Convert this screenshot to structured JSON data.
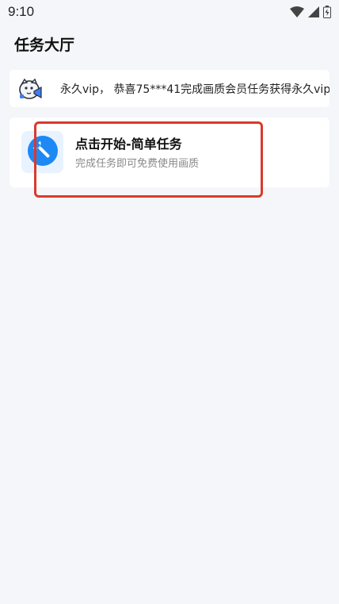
{
  "status_bar": {
    "time": "9:10",
    "icons": [
      "wifi-icon",
      "signal-icon",
      "battery-icon"
    ]
  },
  "page": {
    "title": "任务大厅"
  },
  "notice": {
    "icon": "megaphone-mascot-icon",
    "text": "永久vip， 恭喜75***41完成画质会员任务获得永久vip， 恭"
  },
  "task": {
    "icon": "wrench-icon",
    "title": "点击开始-简单任务",
    "description": "完成任务即可免费使用画质"
  },
  "colors": {
    "background": "#f5f6fa",
    "card": "#ffffff",
    "accent_blue": "#1e88f5",
    "highlight_red": "#d93a2b"
  }
}
